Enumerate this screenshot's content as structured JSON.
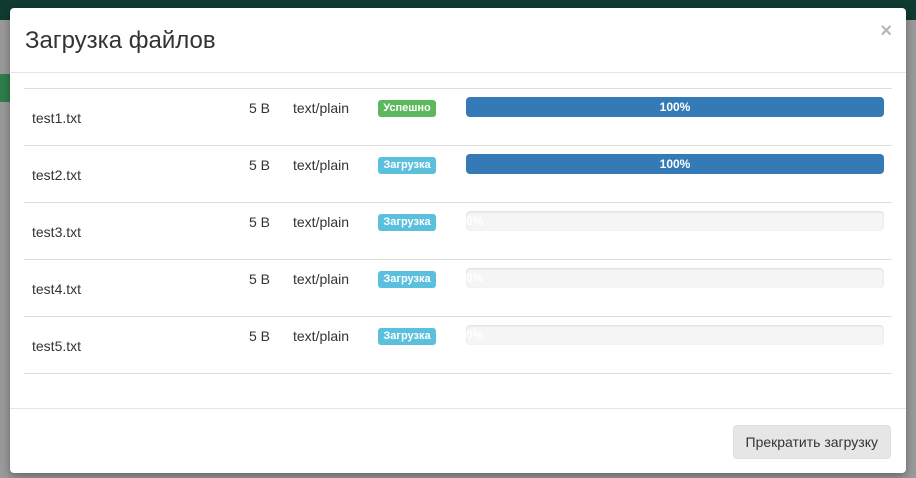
{
  "modal": {
    "title": "Загрузка файлов",
    "close_label": "×",
    "footer": {
      "stop_label": "Прекратить загрузку"
    }
  },
  "files": [
    {
      "name": "test1.txt",
      "size": "5 B",
      "type": "text/plain",
      "status": "Успешно",
      "status_color": "#5cb85c",
      "progress": 100,
      "progress_label": "100%"
    },
    {
      "name": "test2.txt",
      "size": "5 B",
      "type": "text/plain",
      "status": "Загрузка",
      "status_color": "#5bc0de",
      "progress": 100,
      "progress_label": "100%"
    },
    {
      "name": "test3.txt",
      "size": "5 B",
      "type": "text/plain",
      "status": "Загрузка",
      "status_color": "#5bc0de",
      "progress": 0,
      "progress_label": "0%"
    },
    {
      "name": "test4.txt",
      "size": "5 B",
      "type": "text/plain",
      "status": "Загрузка",
      "status_color": "#5bc0de",
      "progress": 0,
      "progress_label": "0%"
    },
    {
      "name": "test5.txt",
      "size": "5 B",
      "type": "text/plain",
      "status": "Загрузка",
      "status_color": "#5bc0de",
      "progress": 0,
      "progress_label": "0%"
    }
  ],
  "colors": {
    "progress_fill": "#337ab7",
    "success": "#5cb85c",
    "info": "#5bc0de"
  }
}
